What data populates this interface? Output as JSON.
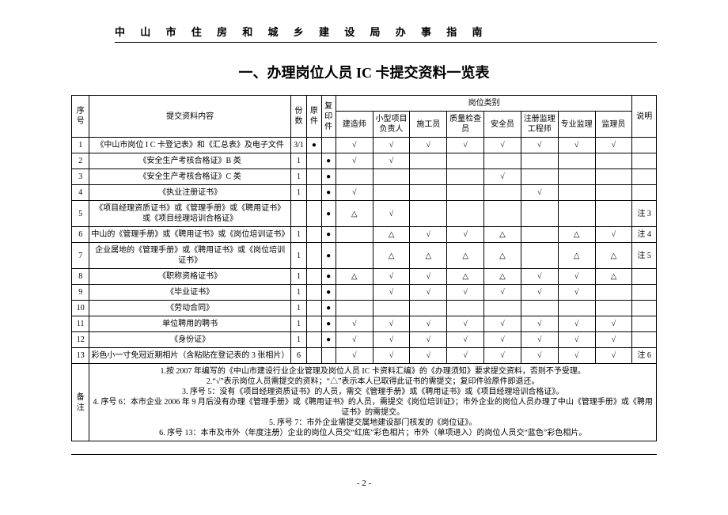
{
  "header": "中 山 市 住 房 和 城 乡 建 设 局 办 事 指 南",
  "title": "一、办理岗位人员 IC 卡提交资料一览表",
  "columns": {
    "idx": "序号",
    "content": "提交资料内容",
    "copies": "份数",
    "orig": "原件",
    "copy": "复印件",
    "cat_header": "岗位类别",
    "roles": [
      "建造师",
      "小型项目负责人",
      "施工员",
      "质量检查员",
      "安全员",
      "注册监理工程师",
      "专业监理",
      "监理员"
    ],
    "note": "说明"
  },
  "rows": [
    {
      "idx": "1",
      "content": "《中山市岗位 I C 卡登记表》和《汇总表》及电子文件",
      "copies": "3/1",
      "orig": "●",
      "copy": "",
      "r": [
        "√",
        "√",
        "√",
        "√",
        "√",
        "√",
        "√",
        "√"
      ],
      "note": ""
    },
    {
      "idx": "2",
      "content": "《安全生产考核合格证》B 类",
      "copies": "1",
      "orig": "",
      "copy": "●",
      "r": [
        "√",
        "√",
        "",
        "",
        "",
        "",
        "",
        ""
      ],
      "note": ""
    },
    {
      "idx": "3",
      "content": "《安全生产考核合格证》C 类",
      "copies": "1",
      "orig": "",
      "copy": "●",
      "r": [
        "",
        "",
        "",
        "",
        "√",
        "",
        "",
        ""
      ],
      "note": ""
    },
    {
      "idx": "4",
      "content": "《执业注册证书》",
      "copies": "1",
      "orig": "",
      "copy": "●",
      "r": [
        "√",
        "",
        "",
        "",
        "",
        "√",
        "",
        ""
      ],
      "note": ""
    },
    {
      "idx": "5",
      "content": "《项目经理资质证书》或《管理手册》或《聘用证书》或《项目经理培训合格证》",
      "copies": "",
      "orig": "",
      "copy": "●",
      "r": [
        "△",
        "√",
        "",
        "",
        "",
        "",
        "",
        ""
      ],
      "note": "注 3"
    },
    {
      "idx": "6",
      "content": "中山的《管理手册》或《聘用证书》或《岗位培训证书》",
      "copies": "1",
      "orig": "",
      "copy": "●",
      "r": [
        "",
        "△",
        "√",
        "√",
        "△",
        "",
        "△",
        "√"
      ],
      "note": "注 4"
    },
    {
      "idx": "7",
      "content": "企业属地的《管理手册》或《聘用证书》或《岗位培训证书》",
      "copies": "1",
      "orig": "",
      "copy": "●",
      "r": [
        "",
        "△",
        "△",
        "△",
        "△",
        "",
        "△",
        "△"
      ],
      "note": "注 5"
    },
    {
      "idx": "8",
      "content": "《职称资格证书》",
      "copies": "1",
      "orig": "",
      "copy": "●",
      "r": [
        "△",
        "√",
        "√",
        "△",
        "△",
        "√",
        "√",
        "△"
      ],
      "note": ""
    },
    {
      "idx": "9",
      "content": "《毕业证书》",
      "copies": "1",
      "orig": "",
      "copy": "●",
      "r": [
        "",
        "√",
        "√",
        "√",
        "√",
        "√",
        "√",
        ""
      ],
      "note": ""
    },
    {
      "idx": "10",
      "content": "《劳动合同》",
      "copies": "1",
      "orig": "",
      "copy": "●",
      "r": [
        "",
        "",
        "",
        "",
        "",
        "",
        "",
        ""
      ],
      "note": ""
    },
    {
      "idx": "11",
      "content": "单位聘用的聘书",
      "copies": "1",
      "orig": "",
      "copy": "●",
      "r": [
        "√",
        "√",
        "√",
        "√",
        "√",
        "√",
        "√",
        "√"
      ],
      "note": ""
    },
    {
      "idx": "12",
      "content": "《身份证》",
      "copies": "1",
      "orig": "",
      "copy": "●",
      "r": [
        "√",
        "√",
        "√",
        "√",
        "√",
        "√",
        "√",
        "√"
      ],
      "note": ""
    },
    {
      "idx": "13",
      "content": "彩色小一寸免冠近期相片（含粘贴在登记表的 3 张相片）",
      "copies": "6",
      "orig": "",
      "copy": "",
      "r": [
        "√",
        "√",
        "√",
        "√",
        "√",
        "√",
        "√",
        "√"
      ],
      "note": "注 6"
    }
  ],
  "notes_label": "备注",
  "notes": [
    "1.按 2007 年编写的《中山市建设行业企业管理及岗位人员 IC 卡资料汇编》的《办理须知》要求提交资料，否则不予受理。",
    "2.“√”表示岗位人员需提交的资料；“△”表示本人已取得此证书的需提交；复印件验原件即退还。",
    "3. 序号 5：没有《项目经理资质证书》的人员，需交《管理手册》或《聘用证书》或《项目经理培训合格证》。",
    "4. 序号 6：本市企业 2006 年 9 月后没有办理《管理手册》或《聘用证书》的人员，需提交《岗位培训证》；市外企业的岗位人员办理了中山《管理手册》或《聘用证书》的需提交。",
    "5. 序号 7：市外企业需提交属地建设部门核发的《岗位证》。",
    "6. 序号 13：本市及市外（年度注册）企业的岗位人员交“红底”彩色相片；市外（单项进入）的岗位人员交“蓝色”彩色相片。"
  ],
  "page_number": "- 2 -"
}
